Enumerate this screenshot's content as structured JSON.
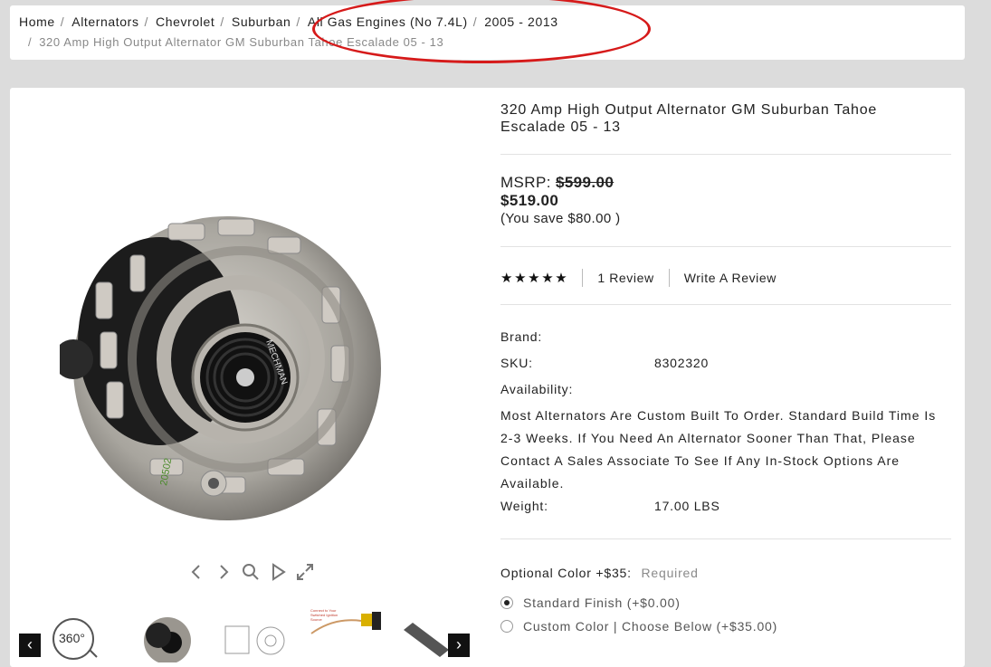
{
  "breadcrumb": {
    "items": [
      "Home",
      "Alternators",
      "Chevrolet",
      "Suburban",
      "All Gas Engines (No 7.4L)",
      "2005 - 2013"
    ],
    "current": "320 Amp High Output Alternator GM Suburban Tahoe Escalade 05 - 13",
    "separator": "/"
  },
  "product": {
    "title": "320 Amp High Output Alternator GM Suburban Tahoe Escalade 05 - 13",
    "msrp_label": "MSRP:",
    "msrp_value": "$599.00",
    "price": "$519.00",
    "savings": "(You save $80.00 )",
    "rating_stars": 5,
    "reviews_label": "1 Review",
    "write_review_label": "Write A Review",
    "specs": {
      "brand_label": "Brand:",
      "brand_value": "",
      "sku_label": "SKU:",
      "sku_value": "8302320",
      "availability_label": "Availability:",
      "availability_text": "Most Alternators Are Custom Built To Order. Standard Build Time Is 2-3 Weeks. If You Need An Alternator Sooner Than That, Please Contact A Sales Associate To See If Any In-Stock Options Are Available.",
      "weight_label": "Weight:",
      "weight_value": "17.00 LBS"
    },
    "option": {
      "label": "Optional Color +$35:",
      "required": "Required",
      "choices": [
        {
          "label": "Standard Finish (+$0.00)",
          "checked": true
        },
        {
          "label": "Custom Color | Choose Below (+$35.00)",
          "checked": false
        }
      ]
    }
  },
  "gallery": {
    "thumb_360_label": "360°",
    "thumb_wiring_text": "Connect to Your Switched Ignition Source",
    "image_marking": "20502",
    "pulley_brand": "MECHMAN",
    "controls": [
      "chevron-left-icon",
      "chevron-right-icon",
      "zoom-icon",
      "play-icon",
      "fullscreen-icon"
    ]
  },
  "colors": {
    "annotation": "#d61a1a",
    "background": "#dcdcdc",
    "card": "#ffffff"
  }
}
